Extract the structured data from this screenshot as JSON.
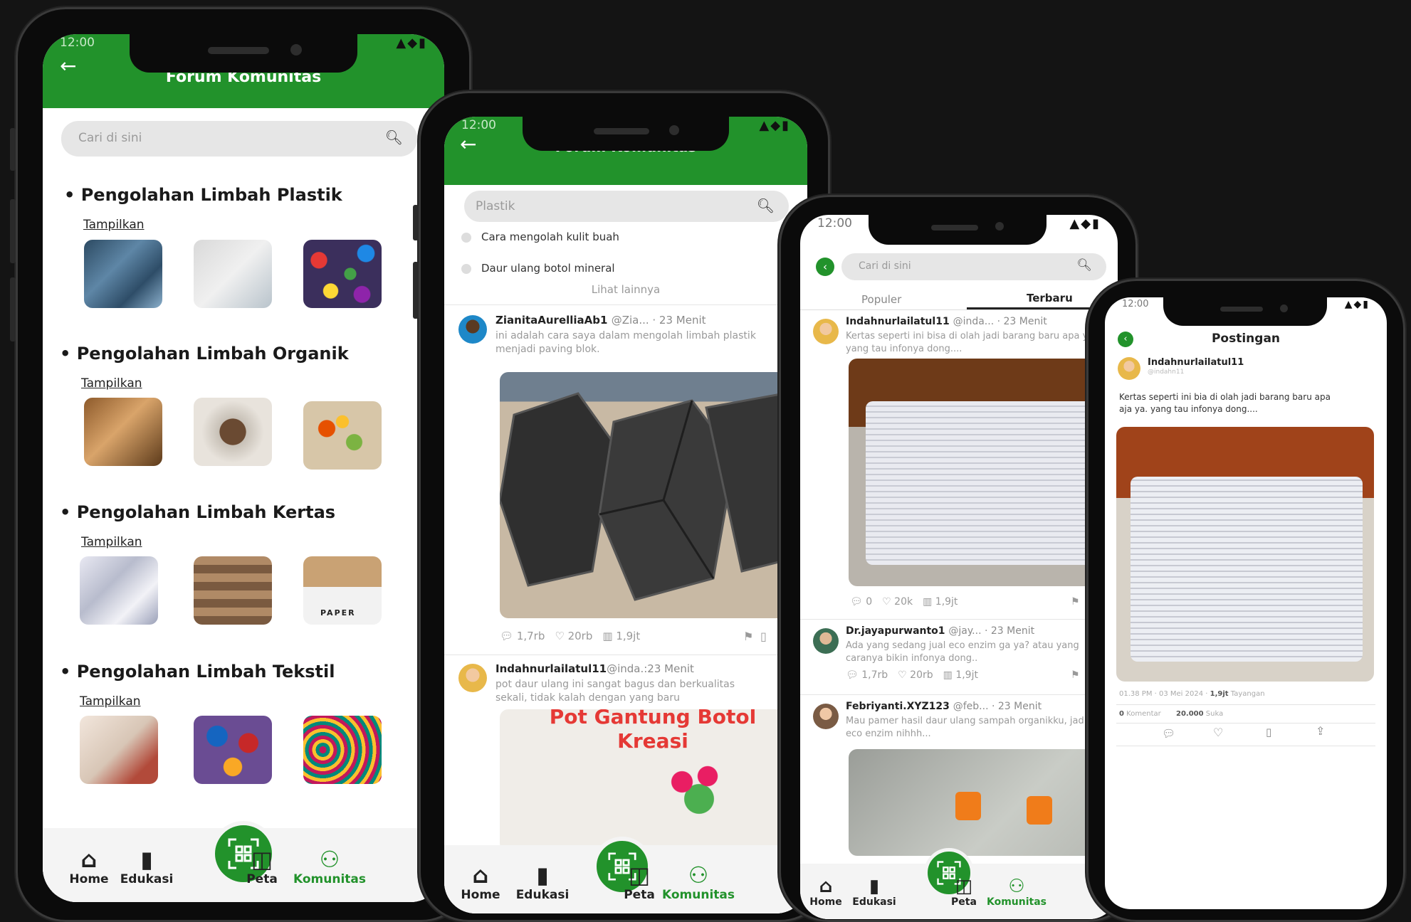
{
  "common": {
    "status_time": "12:00",
    "forum_title": "Forum Komunitas",
    "nav": {
      "home": "Home",
      "edukasi": "Edukasi",
      "peta": "Peta",
      "komunitas": "Komunitas"
    },
    "colors": {
      "brand_green": "#22922b",
      "background": "#141414"
    }
  },
  "phone1": {
    "search_placeholder": "Cari di sini",
    "sections": [
      {
        "title": "Pengolahan Limbah Plastik",
        "link": "Tampilkan"
      },
      {
        "title": "Pengolahan Limbah Organik",
        "link": "Tampilkan"
      },
      {
        "title": "Pengolahan Limbah Kertas",
        "link": "Tampilkan"
      },
      {
        "title": "Pengolahan Limbah Tekstil",
        "link": "Tampilkan"
      }
    ],
    "paper_label": "PAPER"
  },
  "phone2": {
    "search_value": "Plastik",
    "suggestions": [
      "Cara mengolah kulit buah",
      "Daur ulang botol mineral"
    ],
    "see_more": "Lihat lainnya",
    "post1": {
      "user": "ZianitaAurelliaAb1",
      "meta": "@Zia... · 23 Menit",
      "text": "ini adalah cara saya dalam mengolah limbah plastik menjadi paving blok.",
      "comments": "1,7rb",
      "likes": "20rb",
      "views": "1,9jt"
    },
    "post2": {
      "user": "Indahnurlailatul11",
      "meta": "@inda.:23 Menit",
      "text": "pot daur ulang ini sangat bagus dan berkualitas sekali, tidak kalah dengan yang baru",
      "image_caption": "Pot Gantung Botol Kreasi"
    }
  },
  "phone3": {
    "search_placeholder": "Cari di sini",
    "tabs": [
      "Populer",
      "Terbaru"
    ],
    "post1": {
      "user": "Indahnurlailatul11",
      "meta": "@inda... · 23 Menit",
      "text": "Kertas seperti ini bisa di olah jadi barang baru apa ya. yang tau infonya dong....",
      "comments": "0",
      "likes": "20k",
      "views": "1,9jt"
    },
    "post2": {
      "user": "Dr.jayapurwanto1",
      "meta": "@jay... · 23 Menit",
      "text": "Ada yang sedang jual eco enzim ga ya? atau yang caranya bikin infonya dong..",
      "comments": "1,7rb",
      "likes": "20rb",
      "views": "1,9jt"
    },
    "post3": {
      "user": "Febriyanti.XYZ123",
      "meta": "@feb... · 23 Menit",
      "text": "Mau pamer hasil daur ulang sampah organikku, jadi eco enzim nihhh..."
    }
  },
  "phone4": {
    "title": "Postingan",
    "user": "Indahnurlailatul11",
    "handle": "@indahn11",
    "text": "Kertas seperti ini bia di olah jadi barang baru apa aja ya. yang tau infonya dong....",
    "posted": "01.38 PM · 03 Mei 2024 ·",
    "views": "1,9jt",
    "views_label": "Tayangan",
    "comments": "0",
    "comments_label": "Komentar",
    "likes": "20.000",
    "likes_label": "Suka"
  }
}
